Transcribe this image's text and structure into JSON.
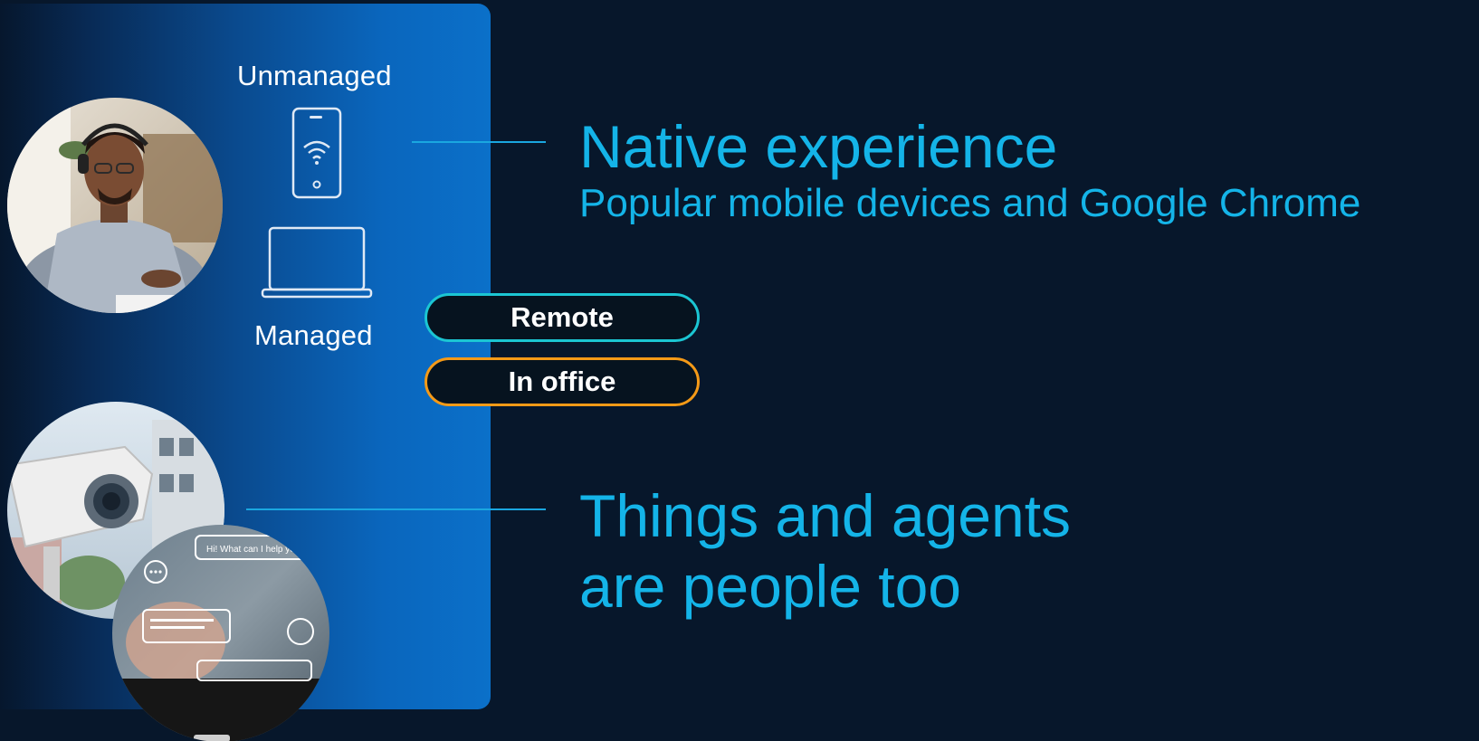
{
  "devices": {
    "unmanaged_label": "Unmanaged",
    "managed_label": "Managed",
    "phone_icon": "mobile-phone-wifi-icon",
    "laptop_icon": "laptop-icon"
  },
  "pills": {
    "remote_label": "Remote",
    "office_label": "In office",
    "remote_color": "#1bc6d3",
    "office_color": "#f59a17"
  },
  "native": {
    "title": "Native experience",
    "subtitle": "Popular mobile devices and Google Chrome"
  },
  "things": {
    "line1": "Things and agents",
    "line2": "are people too"
  },
  "photos": {
    "person": "person-with-headset-photo",
    "camera": "security-camera-photo",
    "chat": "chat-agent-photo"
  },
  "chat_bubble_text": "Hi! What can I help you",
  "colors": {
    "accent": "#14b4e8",
    "background": "#07172b",
    "panel": "#0b70c9"
  }
}
